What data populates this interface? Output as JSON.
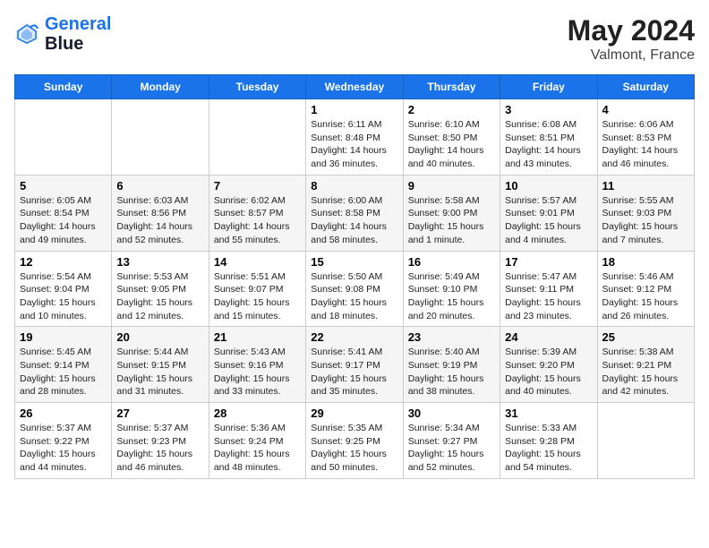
{
  "header": {
    "logo_line1": "General",
    "logo_line2": "Blue",
    "month": "May 2024",
    "location": "Valmont, France"
  },
  "weekdays": [
    "Sunday",
    "Monday",
    "Tuesday",
    "Wednesday",
    "Thursday",
    "Friday",
    "Saturday"
  ],
  "weeks": [
    [
      {
        "day": "",
        "info": ""
      },
      {
        "day": "",
        "info": ""
      },
      {
        "day": "",
        "info": ""
      },
      {
        "day": "1",
        "info": "Sunrise: 6:11 AM\nSunset: 8:48 PM\nDaylight: 14 hours\nand 36 minutes."
      },
      {
        "day": "2",
        "info": "Sunrise: 6:10 AM\nSunset: 8:50 PM\nDaylight: 14 hours\nand 40 minutes."
      },
      {
        "day": "3",
        "info": "Sunrise: 6:08 AM\nSunset: 8:51 PM\nDaylight: 14 hours\nand 43 minutes."
      },
      {
        "day": "4",
        "info": "Sunrise: 6:06 AM\nSunset: 8:53 PM\nDaylight: 14 hours\nand 46 minutes."
      }
    ],
    [
      {
        "day": "5",
        "info": "Sunrise: 6:05 AM\nSunset: 8:54 PM\nDaylight: 14 hours\nand 49 minutes."
      },
      {
        "day": "6",
        "info": "Sunrise: 6:03 AM\nSunset: 8:56 PM\nDaylight: 14 hours\nand 52 minutes."
      },
      {
        "day": "7",
        "info": "Sunrise: 6:02 AM\nSunset: 8:57 PM\nDaylight: 14 hours\nand 55 minutes."
      },
      {
        "day": "8",
        "info": "Sunrise: 6:00 AM\nSunset: 8:58 PM\nDaylight: 14 hours\nand 58 minutes."
      },
      {
        "day": "9",
        "info": "Sunrise: 5:58 AM\nSunset: 9:00 PM\nDaylight: 15 hours\nand 1 minute."
      },
      {
        "day": "10",
        "info": "Sunrise: 5:57 AM\nSunset: 9:01 PM\nDaylight: 15 hours\nand 4 minutes."
      },
      {
        "day": "11",
        "info": "Sunrise: 5:55 AM\nSunset: 9:03 PM\nDaylight: 15 hours\nand 7 minutes."
      }
    ],
    [
      {
        "day": "12",
        "info": "Sunrise: 5:54 AM\nSunset: 9:04 PM\nDaylight: 15 hours\nand 10 minutes."
      },
      {
        "day": "13",
        "info": "Sunrise: 5:53 AM\nSunset: 9:05 PM\nDaylight: 15 hours\nand 12 minutes."
      },
      {
        "day": "14",
        "info": "Sunrise: 5:51 AM\nSunset: 9:07 PM\nDaylight: 15 hours\nand 15 minutes."
      },
      {
        "day": "15",
        "info": "Sunrise: 5:50 AM\nSunset: 9:08 PM\nDaylight: 15 hours\nand 18 minutes."
      },
      {
        "day": "16",
        "info": "Sunrise: 5:49 AM\nSunset: 9:10 PM\nDaylight: 15 hours\nand 20 minutes."
      },
      {
        "day": "17",
        "info": "Sunrise: 5:47 AM\nSunset: 9:11 PM\nDaylight: 15 hours\nand 23 minutes."
      },
      {
        "day": "18",
        "info": "Sunrise: 5:46 AM\nSunset: 9:12 PM\nDaylight: 15 hours\nand 26 minutes."
      }
    ],
    [
      {
        "day": "19",
        "info": "Sunrise: 5:45 AM\nSunset: 9:14 PM\nDaylight: 15 hours\nand 28 minutes."
      },
      {
        "day": "20",
        "info": "Sunrise: 5:44 AM\nSunset: 9:15 PM\nDaylight: 15 hours\nand 31 minutes."
      },
      {
        "day": "21",
        "info": "Sunrise: 5:43 AM\nSunset: 9:16 PM\nDaylight: 15 hours\nand 33 minutes."
      },
      {
        "day": "22",
        "info": "Sunrise: 5:41 AM\nSunset: 9:17 PM\nDaylight: 15 hours\nand 35 minutes."
      },
      {
        "day": "23",
        "info": "Sunrise: 5:40 AM\nSunset: 9:19 PM\nDaylight: 15 hours\nand 38 minutes."
      },
      {
        "day": "24",
        "info": "Sunrise: 5:39 AM\nSunset: 9:20 PM\nDaylight: 15 hours\nand 40 minutes."
      },
      {
        "day": "25",
        "info": "Sunrise: 5:38 AM\nSunset: 9:21 PM\nDaylight: 15 hours\nand 42 minutes."
      }
    ],
    [
      {
        "day": "26",
        "info": "Sunrise: 5:37 AM\nSunset: 9:22 PM\nDaylight: 15 hours\nand 44 minutes."
      },
      {
        "day": "27",
        "info": "Sunrise: 5:37 AM\nSunset: 9:23 PM\nDaylight: 15 hours\nand 46 minutes."
      },
      {
        "day": "28",
        "info": "Sunrise: 5:36 AM\nSunset: 9:24 PM\nDaylight: 15 hours\nand 48 minutes."
      },
      {
        "day": "29",
        "info": "Sunrise: 5:35 AM\nSunset: 9:25 PM\nDaylight: 15 hours\nand 50 minutes."
      },
      {
        "day": "30",
        "info": "Sunrise: 5:34 AM\nSunset: 9:27 PM\nDaylight: 15 hours\nand 52 minutes."
      },
      {
        "day": "31",
        "info": "Sunrise: 5:33 AM\nSunset: 9:28 PM\nDaylight: 15 hours\nand 54 minutes."
      },
      {
        "day": "",
        "info": ""
      }
    ]
  ]
}
